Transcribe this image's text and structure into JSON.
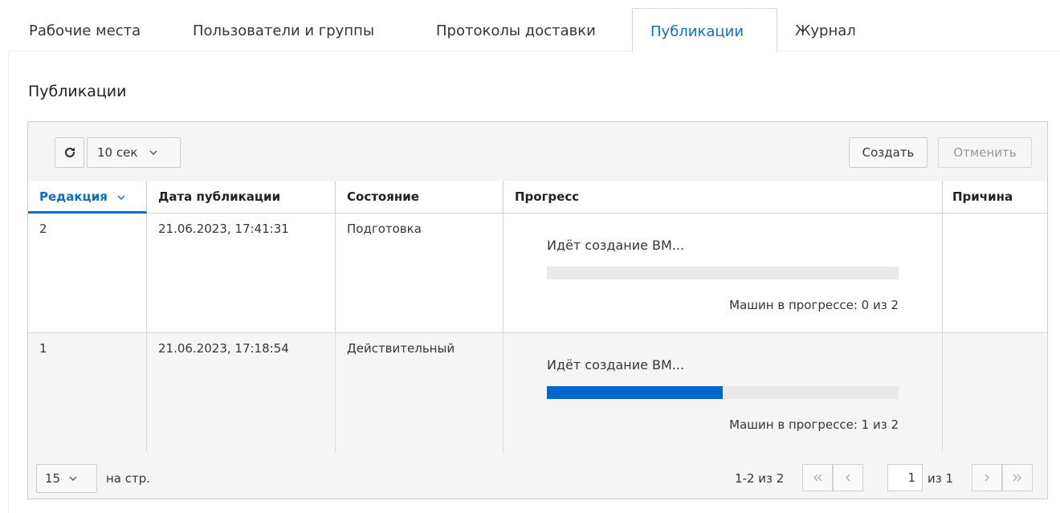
{
  "tabs": [
    {
      "label": "Рабочие места"
    },
    {
      "label": "Пользователи и группы"
    },
    {
      "label": "Протоколы доставки"
    },
    {
      "label": "Публикации"
    },
    {
      "label": "Журнал"
    }
  ],
  "active_tab": "Публикации",
  "section_title": "Публикации",
  "toolbar": {
    "refresh_icon": "refresh-icon",
    "interval_value": "10 сек",
    "create_label": "Создать",
    "cancel_label": "Отменить"
  },
  "table": {
    "columns": [
      "Редакция",
      "Дата публикации",
      "Состояние",
      "Прогресс",
      "Причина"
    ],
    "sorted_column": "Редакция",
    "rows": [
      {
        "edition": "2",
        "date": "21.06.2023, 17:41:31",
        "state": "Подготовка",
        "progress_title": "Идёт создание ВМ...",
        "progress_fraction": 0,
        "progress_count": "Машин в прогрессе: 0 из 2",
        "reason": ""
      },
      {
        "edition": "1",
        "date": "21.06.2023, 17:18:54",
        "state": "Действительный",
        "progress_title": "Идёт создание ВМ...",
        "progress_fraction": 0.5,
        "progress_count": "Машин в прогрессе: 1 из 2",
        "reason": ""
      }
    ]
  },
  "footer": {
    "per_page_value": "15",
    "per_page_label": "на стр.",
    "range_text": "1-2 из 2",
    "page_value": "1",
    "page_total": "из 1"
  },
  "colors": {
    "accent": "#0f6ec0",
    "progress_fill": "#0066cc",
    "progress_track": "#e9e9e9"
  }
}
